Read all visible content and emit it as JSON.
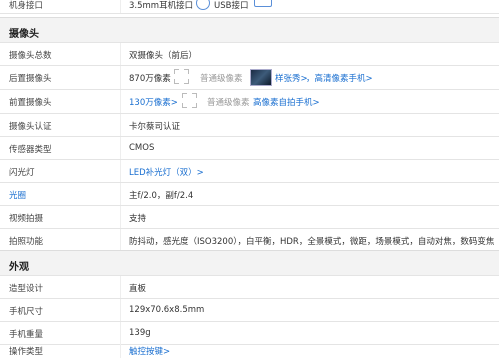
{
  "top_row": {
    "label": "机身接口",
    "value": "3.5mm耳机接口",
    "usb_label": "USB接口"
  },
  "camera": {
    "title": "摄像头",
    "rows": [
      {
        "label": "摄像头总数",
        "value": "双摄像头（前后）"
      },
      {
        "label": "后置摄像头",
        "value": "870万像素",
        "ordinary": "普通级像素",
        "sample": "样张秀>",
        "link": "，高清像素手机>"
      },
      {
        "label": "前置摄像头",
        "value": "130万像素>",
        "ordinary": "普通级像素",
        "link": "高像素自拍手机>"
      },
      {
        "label": "摄像头认证",
        "value": "卡尔蔡司认证"
      },
      {
        "label": "传感器类型",
        "value": "CMOS"
      },
      {
        "label": "闪光灯",
        "value": "LED补光灯（双）>"
      },
      {
        "label": "光圈",
        "value": "主f/2.0，副f/2.4"
      },
      {
        "label": "视频拍摄",
        "value": "支持"
      },
      {
        "label": "拍照功能",
        "value": "防抖动，感光度（ISO3200），白平衡，HDR，全景模式，微距，场景模式，自动对焦，数码变焦"
      }
    ]
  },
  "appearance": {
    "title": "外观",
    "rows": [
      {
        "label": "造型设计",
        "value": "直板"
      },
      {
        "label": "手机尺寸",
        "value": "129x70.6x8.5mm"
      },
      {
        "label": "手机重量",
        "value": "139g"
      },
      {
        "label": "操作类型",
        "value": "触控按键>"
      }
    ]
  }
}
